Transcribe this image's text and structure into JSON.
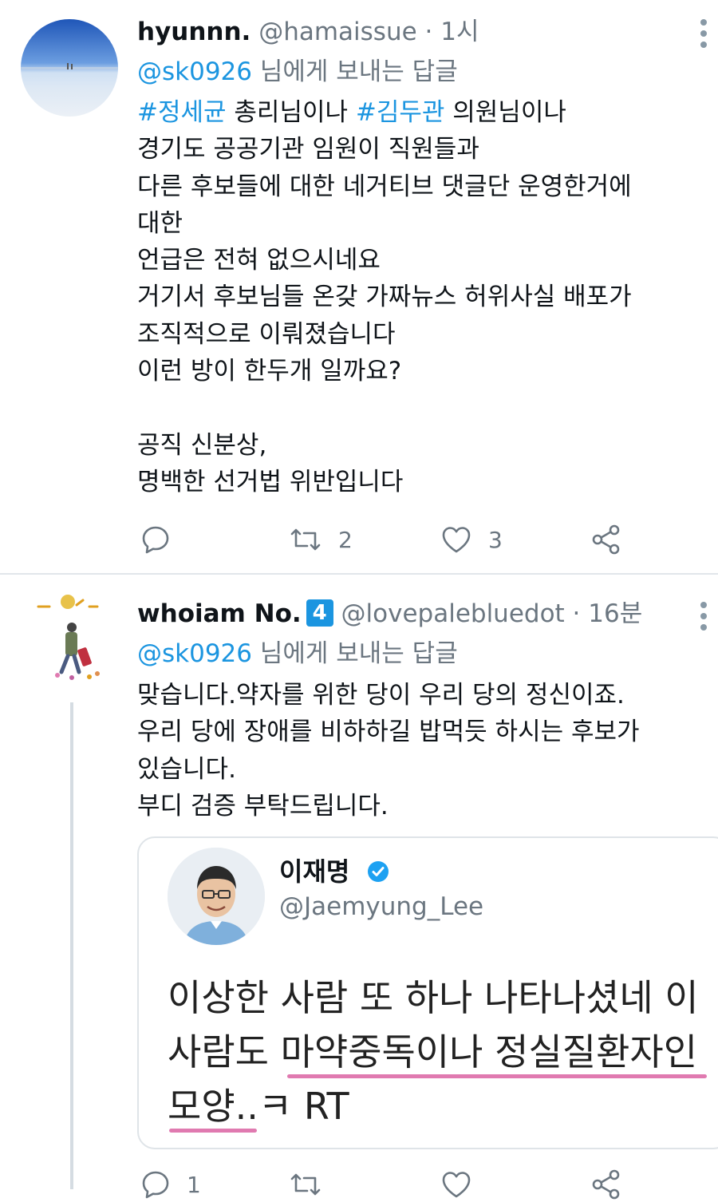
{
  "tweets": [
    {
      "name": "hyunnn.",
      "handle": "@hamaissue",
      "separator": " · ",
      "time": "1시",
      "reply_prefix": "",
      "reply_mention": "@sk0926",
      "reply_suffix": " 님에게 보내는 답글",
      "lines": [
        {
          "tag1": "#정세균",
          "mid": " 총리님이나 ",
          "tag2": "#김두관",
          "tail": " 의원님이나"
        },
        "경기도 공공기관 임원이 직원들과",
        "다른 후보들에 대한 네거티브 댓글단 운영한거에",
        "대한",
        "언급은 전혀 없으시네요",
        "거기서 후보님들 온갖 가짜뉴스 허위사실 배포가",
        "조직적으로 이뤄졌습니다",
        "이런 방이 한두개 일까요?",
        "",
        "공직 신분상,",
        "명백한 선거법 위반입니다"
      ],
      "actions": {
        "reply_count": "",
        "retweet_count": "2",
        "like_count": "3"
      }
    },
    {
      "name": "whoiam No.",
      "badge": "4",
      "handle": "@lovepalebluedot",
      "separator": " · ",
      "time": "16분",
      "reply_mention": "@sk0926",
      "reply_suffix": " 님에게 보내는 답글",
      "lines": [
        "맞습니다.약자를 위한 당이 우리 당의 정신이죠.",
        "우리 당에 장애를 비하하길 밥먹듯 하시는 후보가",
        "있습니다.",
        "부디 검증 부탁드립니다."
      ],
      "quote": {
        "name": "이재명",
        "handle": "@Jaemyung_Lee",
        "lines": [
          "이상한 사람 또 하나 나타나셨네 이",
          "사람도 마약중독이나 정실질환자인",
          "모양..ㅋ RT"
        ]
      },
      "actions": {
        "reply_count": "1",
        "retweet_count": "",
        "like_count": ""
      }
    }
  ],
  "colors": {
    "link": "#1b95e0",
    "muted": "#6b7680",
    "underline": "#e07ab0",
    "divider": "#e1e6ea"
  },
  "icons": [
    "reply-icon",
    "retweet-icon",
    "like-icon",
    "share-icon",
    "more-icon",
    "verified-icon"
  ]
}
